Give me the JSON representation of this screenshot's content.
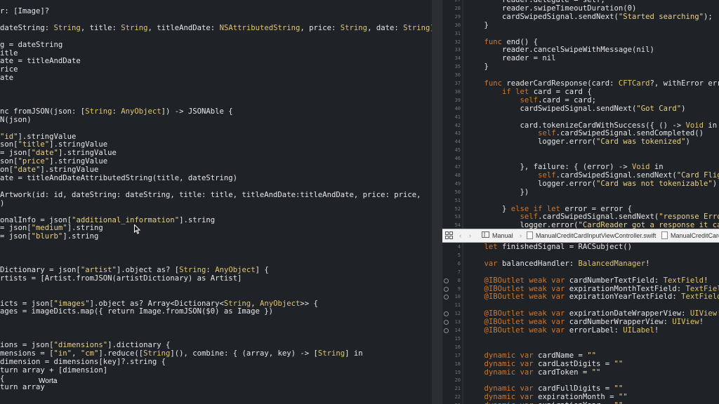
{
  "colors": {
    "plain": "#e6e6e6",
    "keyword": "#cc7832",
    "type": "#e0c46c",
    "string": "#e9d18a",
    "linenum": "#6f747c",
    "accent": "#ffffff"
  },
  "tooltip_text": "Worta",
  "jump_bar": {
    "grid_icon": "grid-icon",
    "back_icon": "chevron-left-icon",
    "forward_icon": "chevron-right-icon",
    "manual_label": "Manual",
    "file1_label": "ManualCreditCardInputViewController.swift",
    "file2_label": "ManualCreditCard"
  },
  "left_editor": [
    [
      [
        "plain",
        "r: [Image]?"
      ]
    ],
    [],
    [
      [
        "plain",
        "dateString: "
      ],
      [
        "type",
        "String"
      ],
      [
        "plain",
        ", title: "
      ],
      [
        "type",
        "String"
      ],
      [
        "plain",
        ", titleAndDate: "
      ],
      [
        "type",
        "NSAttributedString"
      ],
      [
        "plain",
        ", price: "
      ],
      [
        "type",
        "String"
      ],
      [
        "plain",
        ", date: "
      ],
      [
        "type",
        "String"
      ],
      [
        "plain",
        ") {"
      ]
    ],
    [],
    [
      [
        "plain",
        "g = dateString"
      ]
    ],
    [
      [
        "plain",
        "itle"
      ]
    ],
    [
      [
        "plain",
        "ate = titleAndDate"
      ]
    ],
    [
      [
        "plain",
        "rice"
      ]
    ],
    [
      [
        "plain",
        "ate"
      ]
    ],
    [],
    [],
    [],
    [
      [
        "plain",
        "nc fromJSON(json: ["
      ],
      [
        "type",
        "String"
      ],
      [
        "plain",
        ": "
      ],
      [
        "type",
        "AnyObject"
      ],
      [
        "plain",
        "]) -> JSONAble {"
      ]
    ],
    [
      [
        "plain",
        "N(json)"
      ]
    ],
    [],
    [
      [
        "string",
        "\"id\""
      ],
      [
        "plain",
        "].stringValue"
      ]
    ],
    [
      [
        "plain",
        "son["
      ],
      [
        "string",
        "\"title\""
      ],
      [
        "plain",
        "].stringValue"
      ]
    ],
    [
      [
        "plain",
        "= json["
      ],
      [
        "string",
        "\"date\""
      ],
      [
        "plain",
        "].stringValue"
      ]
    ],
    [
      [
        "plain",
        "son["
      ],
      [
        "string",
        "\"price\""
      ],
      [
        "plain",
        "].stringValue"
      ]
    ],
    [
      [
        "plain",
        "on["
      ],
      [
        "string",
        "\"date\""
      ],
      [
        "plain",
        "].stringValue"
      ]
    ],
    [
      [
        "plain",
        "ate = titleAndDateAttributedString(title, dateString)"
      ]
    ],
    [],
    [
      [
        "plain",
        "Artwork(id: id, dateString: dateString, title: title, titleAndDate:titleAndDate, price: price,"
      ]
    ],
    [
      [
        "plain",
        ")"
      ]
    ],
    [],
    [
      [
        "plain",
        "onalInfo = json["
      ],
      [
        "string",
        "\"additional_information\""
      ],
      [
        "plain",
        "].string"
      ]
    ],
    [
      [
        "plain",
        "= json["
      ],
      [
        "string",
        "\"medium\""
      ],
      [
        "plain",
        "].string"
      ]
    ],
    [
      [
        "plain",
        "= json["
      ],
      [
        "string",
        "\"blurb\""
      ],
      [
        "plain",
        "].string"
      ]
    ],
    [],
    [],
    [],
    [
      [
        "plain",
        "Dictionary = json["
      ],
      [
        "string",
        "\"artist\""
      ],
      [
        "plain",
        "].object as? ["
      ],
      [
        "type",
        "String"
      ],
      [
        "plain",
        ": "
      ],
      [
        "type",
        "AnyObject"
      ],
      [
        "plain",
        "] {"
      ]
    ],
    [
      [
        "plain",
        "rtists = [Artist.fromJSON(artistDictionary) as Artist]"
      ]
    ],
    [],
    [],
    [
      [
        "plain",
        "icts = json["
      ],
      [
        "string",
        "\"images\""
      ],
      [
        "plain",
        "].object as? Array<Dictionary<"
      ],
      [
        "type",
        "String"
      ],
      [
        "plain",
        ", "
      ],
      [
        "type",
        "AnyObject"
      ],
      [
        "plain",
        ">> {"
      ]
    ],
    [
      [
        "plain",
        "ages = imageDicts.map({ return Image.fromJSON($0) as Image })"
      ]
    ],
    [],
    [],
    [],
    [
      [
        "plain",
        "ions = json["
      ],
      [
        "string",
        "\"dimensions\""
      ],
      [
        "plain",
        "].dictionary {"
      ]
    ],
    [
      [
        "plain",
        "mensions = ["
      ],
      [
        "string",
        "\"in\""
      ],
      [
        "plain",
        ", "
      ],
      [
        "string",
        "\"cm\""
      ],
      [
        "plain",
        "].reduce(["
      ],
      [
        "type",
        "String"
      ],
      [
        "plain",
        "](), combine: { (array, key) -> ["
      ],
      [
        "type",
        "String"
      ],
      [
        "plain",
        "] in"
      ]
    ],
    [
      [
        "plain",
        "dimension = dimensions[key]?.string {"
      ]
    ],
    [
      [
        "plain",
        "turn array + [dimension]"
      ]
    ],
    [
      [
        "plain",
        "{"
      ]
    ],
    [
      [
        "plain",
        "turn array"
      ]
    ]
  ],
  "right_top_editor": {
    "first_line_number": 27,
    "lines": [
      [
        [
          "plain",
          "        reader.delegate = self;"
        ]
      ],
      [
        [
          "plain",
          "        reader.swipeTimeoutDuration(0)"
        ]
      ],
      [
        [
          "plain",
          "        cardSwipedSignal.sendNext("
        ],
        [
          "string",
          "\"Started searching\""
        ],
        [
          "plain",
          ");"
        ]
      ],
      [
        [
          "plain",
          "    }"
        ]
      ],
      [],
      [
        [
          "plain",
          "    "
        ],
        [
          "keyword",
          "func"
        ],
        [
          "plain",
          " end() {"
        ]
      ],
      [
        [
          "plain",
          "        reader.cancelSwipeWithMessage(nil)"
        ]
      ],
      [
        [
          "plain",
          "        reader = nil"
        ]
      ],
      [
        [
          "plain",
          "    }"
        ]
      ],
      [],
      [
        [
          "plain",
          "    "
        ],
        [
          "keyword",
          "func"
        ],
        [
          "plain",
          " readerCardResponse(card: "
        ],
        [
          "type",
          "CFTCard"
        ],
        [
          "plain",
          "?, withError erro"
        ]
      ],
      [
        [
          "plain",
          "        "
        ],
        [
          "keyword",
          "if let"
        ],
        [
          "plain",
          " card = card {"
        ]
      ],
      [
        [
          "plain",
          "            "
        ],
        [
          "keyword",
          "self"
        ],
        [
          "plain",
          ".card = card;"
        ]
      ],
      [
        [
          "plain",
          "            cardSwipedSignal.sendNext("
        ],
        [
          "string",
          "\"Got Card\""
        ],
        [
          "plain",
          ")"
        ]
      ],
      [],
      [
        [
          "plain",
          "            card.tokenizeCardWithSuccess({ () -> "
        ],
        [
          "type",
          "Void"
        ],
        [
          "plain",
          " in"
        ]
      ],
      [
        [
          "plain",
          "                "
        ],
        [
          "keyword",
          "self"
        ],
        [
          "plain",
          ".cardSwipedSignal.sendCompleted()"
        ]
      ],
      [
        [
          "plain",
          "                logger.error("
        ],
        [
          "string",
          "\"Card was tokenized\""
        ],
        [
          "plain",
          ")"
        ]
      ],
      [],
      [],
      [
        [
          "plain",
          "            }, failure: { (error) -> "
        ],
        [
          "type",
          "Void"
        ],
        [
          "plain",
          " in"
        ]
      ],
      [
        [
          "plain",
          "                "
        ],
        [
          "keyword",
          "self"
        ],
        [
          "plain",
          ".cardSwipedSignal.sendNext("
        ],
        [
          "string",
          "\"Card Fligh"
        ]
      ],
      [
        [
          "plain",
          "                logger.error("
        ],
        [
          "string",
          "\"Card was not tokenizable\""
        ],
        [
          "plain",
          ")"
        ]
      ],
      [
        [
          "plain",
          "            })"
        ]
      ],
      [],
      [
        [
          "plain",
          "        } "
        ],
        [
          "keyword",
          "else if let"
        ],
        [
          "plain",
          " error = error {"
        ]
      ],
      [
        [
          "plain",
          "            "
        ],
        [
          "keyword",
          "self"
        ],
        [
          "plain",
          ".cardSwipedSignal.sendNext("
        ],
        [
          "string",
          "\"response Error"
        ]
      ],
      [
        [
          "plain",
          "            logger.error("
        ],
        [
          "string",
          "\"CardReader got a response it can"
        ]
      ]
    ]
  },
  "right_bottom_editor": {
    "first_line_number": 4,
    "outlet_lines": [
      8,
      9,
      10,
      12,
      13,
      14
    ],
    "lines": [
      [
        [
          "plain",
          "    "
        ],
        [
          "keyword",
          "let"
        ],
        [
          "plain",
          " finishedSignal = RACSubject()"
        ]
      ],
      [],
      [
        [
          "plain",
          "    "
        ],
        [
          "keyword",
          "var"
        ],
        [
          "plain",
          " balancedHandler: "
        ],
        [
          "type",
          "BalancedManager"
        ],
        [
          "plain",
          "!"
        ]
      ],
      [],
      [
        [
          "plain",
          "    "
        ],
        [
          "keyword",
          "@IBOutlet weak var"
        ],
        [
          "plain",
          " cardNumberTextField: "
        ],
        [
          "type",
          "TextField"
        ],
        [
          "plain",
          "!"
        ]
      ],
      [
        [
          "plain",
          "    "
        ],
        [
          "keyword",
          "@IBOutlet weak var"
        ],
        [
          "plain",
          " expirationMonthTextField: "
        ],
        [
          "type",
          "TextFiel"
        ]
      ],
      [
        [
          "plain",
          "    "
        ],
        [
          "keyword",
          "@IBOutlet weak var"
        ],
        [
          "plain",
          " expirationYearTextField: "
        ],
        [
          "type",
          "TextField"
        ],
        [
          "plain",
          "!"
        ]
      ],
      [],
      [
        [
          "plain",
          "    "
        ],
        [
          "keyword",
          "@IBOutlet weak var"
        ],
        [
          "plain",
          " expirationDateWrapperView: "
        ],
        [
          "type",
          "UIView"
        ],
        [
          "plain",
          "!"
        ]
      ],
      [
        [
          "plain",
          "    "
        ],
        [
          "keyword",
          "@IBOutlet weak var"
        ],
        [
          "plain",
          " cardNumberWrapperView: "
        ],
        [
          "type",
          "UIView"
        ],
        [
          "plain",
          "!"
        ]
      ],
      [
        [
          "plain",
          "    "
        ],
        [
          "keyword",
          "@IBOutlet weak var"
        ],
        [
          "plain",
          " errorLabel: "
        ],
        [
          "type",
          "UILabel"
        ],
        [
          "plain",
          "!"
        ]
      ],
      [],
      [],
      [
        [
          "plain",
          "    "
        ],
        [
          "keyword",
          "dynamic var"
        ],
        [
          "plain",
          " cardName = "
        ],
        [
          "string",
          "\"\""
        ]
      ],
      [
        [
          "plain",
          "    "
        ],
        [
          "keyword",
          "dynamic var"
        ],
        [
          "plain",
          " cardLastDigits = "
        ],
        [
          "string",
          "\"\""
        ]
      ],
      [
        [
          "plain",
          "    "
        ],
        [
          "keyword",
          "dynamic var"
        ],
        [
          "plain",
          " cardToken = "
        ],
        [
          "string",
          "\"\""
        ]
      ],
      [],
      [
        [
          "plain",
          "    "
        ],
        [
          "keyword",
          "dynamic var"
        ],
        [
          "plain",
          " cardFullDigits = "
        ],
        [
          "string",
          "\"\""
        ]
      ],
      [
        [
          "plain",
          "    "
        ],
        [
          "keyword",
          "dynamic var"
        ],
        [
          "plain",
          " expirationMonth = "
        ],
        [
          "string",
          "\"\""
        ]
      ],
      [
        [
          "plain",
          "    "
        ],
        [
          "keyword",
          "dynamic var"
        ],
        [
          "plain",
          " expirationYear = "
        ],
        [
          "string",
          "\"\""
        ]
      ]
    ]
  }
}
